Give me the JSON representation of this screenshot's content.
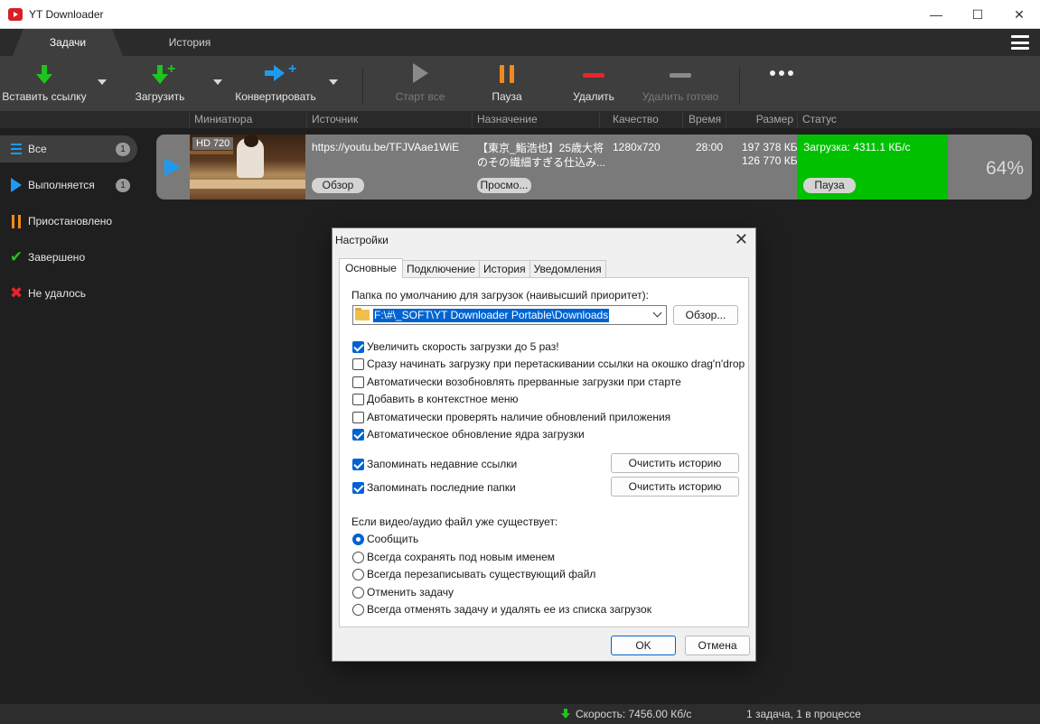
{
  "window": {
    "title": "YT Downloader",
    "controls": {
      "minimize": "—",
      "maximize": "☐",
      "close": "✕"
    }
  },
  "tabs": [
    {
      "label": "Задачи",
      "active": true
    },
    {
      "label": "История",
      "active": false
    }
  ],
  "toolbar": {
    "paste": "Вставить ссылку",
    "download": "Загрузить",
    "convert": "Конвертировать",
    "start_all": "Старт все",
    "pause": "Пауза",
    "delete": "Удалить",
    "delete_done": "Удалить готово",
    "more_icon": "more-dots-icon",
    "plus": "+"
  },
  "columns": [
    "Миниатюра",
    "Источник",
    "Назначение",
    "Качество",
    "Время",
    "Размер",
    "Статус"
  ],
  "sidebar": {
    "items": [
      {
        "label": "Все",
        "badge": "1",
        "icon": "list-icon"
      },
      {
        "label": "Выполняется",
        "badge": "1",
        "icon": "play-icon"
      },
      {
        "label": "Приостановлено",
        "icon": "pause-icon"
      },
      {
        "label": "Завершено",
        "icon": "check-icon",
        "glyph": "✔"
      },
      {
        "label": "Не удалось",
        "icon": "x-icon",
        "glyph": "✖"
      }
    ]
  },
  "download": {
    "thumb_badge": "HD 720",
    "source": "https://youtu.be/TFJVAae1WiE",
    "dest_line1": "【東京_鮨浩也】25歳大将",
    "dest_line2": "のその繊細すぎる仕込み...",
    "quality": "1280x720",
    "time": "28:00",
    "size_total": "197 378 КБ",
    "size_done": "126 770 КБ",
    "status": "Загрузка: 4311.1 КБ/с",
    "percent": "64%",
    "progress": 0.64,
    "browse_label": "Обзор",
    "view_label": "Просмо...",
    "pause_label": "Пауза",
    "status_color": "#00c000"
  },
  "statusbar": {
    "speed": "Скорость: 7456.00 Кб/с",
    "tasks": "1 задача, 1 в процессе"
  },
  "dialog": {
    "title": "Настройки",
    "close": "✕",
    "tabs": [
      "Основные",
      "Подключение",
      "История",
      "Уведомления"
    ],
    "folder_label": "Папка по умолчанию для загрузок (наивысший приоритет):",
    "folder_path": "F:\\#\\_SOFT\\YT Downloader Portable\\Downloads",
    "browse": "Обзор...",
    "options": [
      {
        "label": "Увеличить скорость загрузки до 5 раз!",
        "checked": true
      },
      {
        "label": "Сразу начинать загрузку при перетаскивании ссылки на окошко drag'n'drop",
        "checked": false
      },
      {
        "label": "Автоматически возобновлять прерванные загрузки при старте",
        "checked": false
      },
      {
        "label": "Добавить в контекстное меню",
        "checked": false
      },
      {
        "label": "Автоматически проверять наличие обновлений приложения",
        "checked": false
      },
      {
        "label": "Автоматическое обновление ядра загрузки",
        "checked": true
      }
    ],
    "remember_links": {
      "label": "Запоминать недавние ссылки",
      "checked": true
    },
    "remember_folders": {
      "label": "Запоминать последние папки",
      "checked": true
    },
    "clear_history": "Очистить историю",
    "exists_label": "Если видео/аудио файл уже существует:",
    "radios": [
      {
        "label": "Сообщить",
        "selected": true
      },
      {
        "label": "Всегда сохранять под новым именем",
        "selected": false
      },
      {
        "label": "Всегда перезаписывать существующий файл",
        "selected": false
      },
      {
        "label": "Отменить задачу",
        "selected": false
      },
      {
        "label": "Всегда отменять задачу и удалять ее из списка загрузок",
        "selected": false
      }
    ],
    "ok": "OK",
    "cancel": "Отмена"
  }
}
